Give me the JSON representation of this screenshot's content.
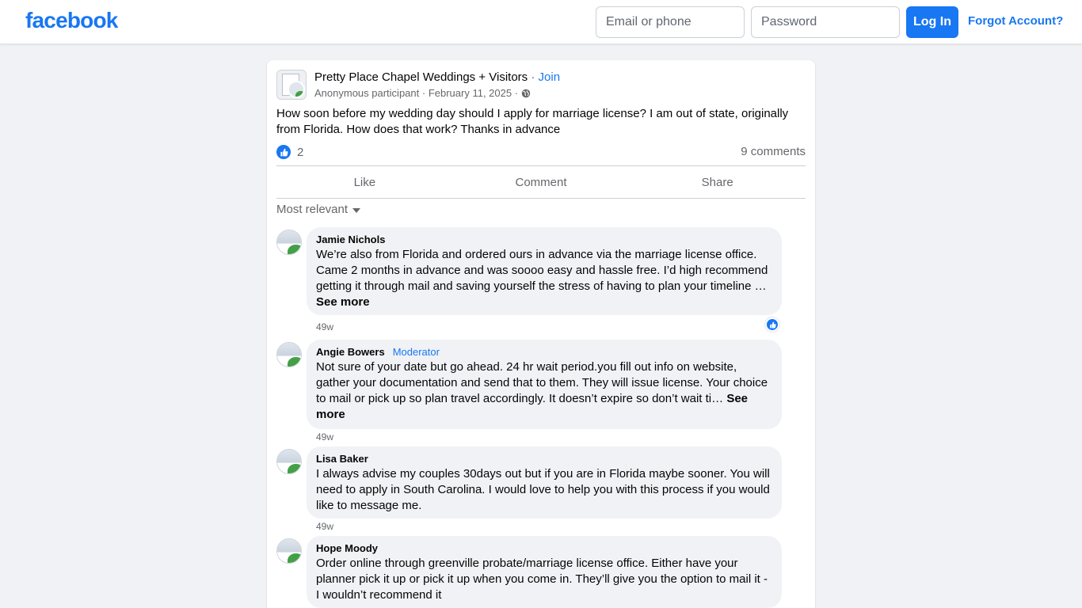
{
  "header": {
    "logo": "facebook",
    "email_placeholder": "Email or phone",
    "password_placeholder": "Password",
    "login_label": "Log In",
    "forgot_label": "Forgot Account?"
  },
  "post": {
    "group_name": "Pretty Place Chapel Weddings + Visitors",
    "join_label": "Join",
    "author": "Anonymous participant",
    "date": "February 11, 2025",
    "text": "How soon before my wedding day should I apply for marriage license? I am out of state, originally from Florida. How does that work? Thanks in advance",
    "like_count": "2",
    "comment_count": "9 comments",
    "actions": {
      "like": "Like",
      "comment": "Comment",
      "share": "Share"
    },
    "sort_label": "Most relevant"
  },
  "comments": [
    {
      "name": "Jamie Nichols",
      "badge": "",
      "text": "We’re also from Florida and ordered ours in advance via the marriage license office. Came 2 months in advance and was soooo easy and hassle free. I’d high recommend getting it through mail and saving yourself the stress of having to plan your timeline …",
      "see_more": "See more",
      "time": "49w"
    },
    {
      "name": "Angie Bowers",
      "badge": "Moderator",
      "text": "Not sure of your date but go ahead. 24 hr wait period.you fill out info on website, gather your documentation and send that to them. They will issue license. Your choice to mail or pick up so plan travel accordingly. It doesn’t expire so don’t wait ti…",
      "see_more": "See more",
      "time": "49w"
    },
    {
      "name": "Lisa Baker",
      "badge": "",
      "text": "I always advise my couples 30days out but if you are in Florida maybe sooner. You will need to apply in South Carolina. I would love to help you with this process if you would like to message me.",
      "time": "49w"
    },
    {
      "name": "Hope Moody",
      "badge": "",
      "text": "Order online through greenville probate/marriage license office. Either have your planner pick it up or pick it up when you come in. They’ll give you the option to mail it - I wouldn’t recommend it"
    }
  ]
}
